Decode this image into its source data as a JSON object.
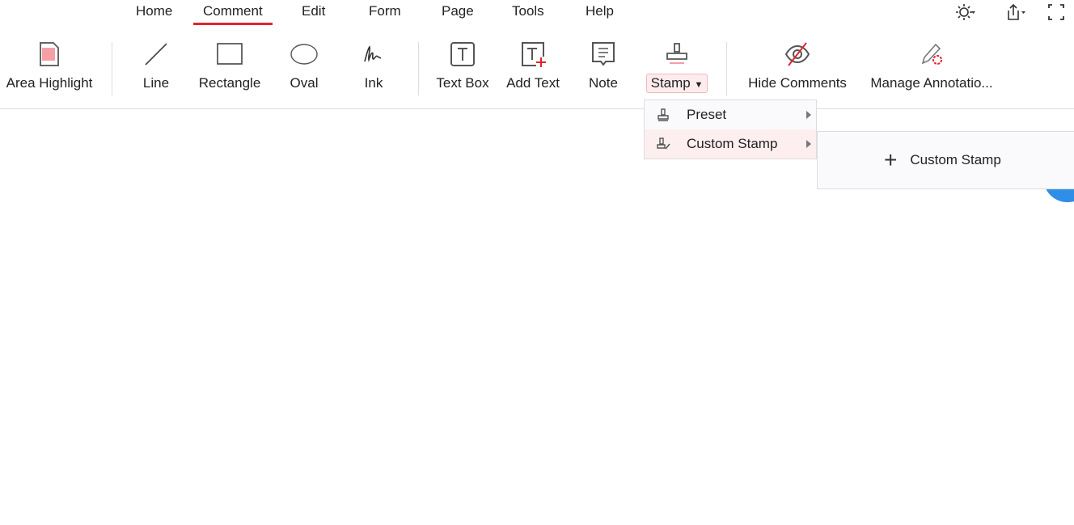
{
  "menu": {
    "tabs": [
      {
        "label": "Home"
      },
      {
        "label": "Comment",
        "active": true
      },
      {
        "label": "Edit"
      },
      {
        "label": "Form"
      },
      {
        "label": "Page"
      },
      {
        "label": "Tools"
      },
      {
        "label": "Help"
      }
    ],
    "right_icons": [
      "theme-sun-icon",
      "share-icon",
      "fullscreen-icon"
    ]
  },
  "toolbar": {
    "area_highlight": "Area Highlight",
    "line": "Line",
    "rectangle": "Rectangle",
    "oval": "Oval",
    "ink": "Ink",
    "text_box": "Text Box",
    "add_text": "Add Text",
    "note": "Note",
    "stamp": "Stamp",
    "hide_comments": "Hide Comments",
    "manage_annotations": "Manage Annotatio..."
  },
  "stamp_menu": {
    "items": [
      {
        "label": "Preset"
      },
      {
        "label": "Custom Stamp"
      }
    ]
  },
  "custom_stamp_submenu": {
    "add_label": "Custom Stamp"
  },
  "colors": {
    "accent": "#e0242f",
    "hover": "#fdeef0",
    "blue": "#2f8ee6"
  }
}
